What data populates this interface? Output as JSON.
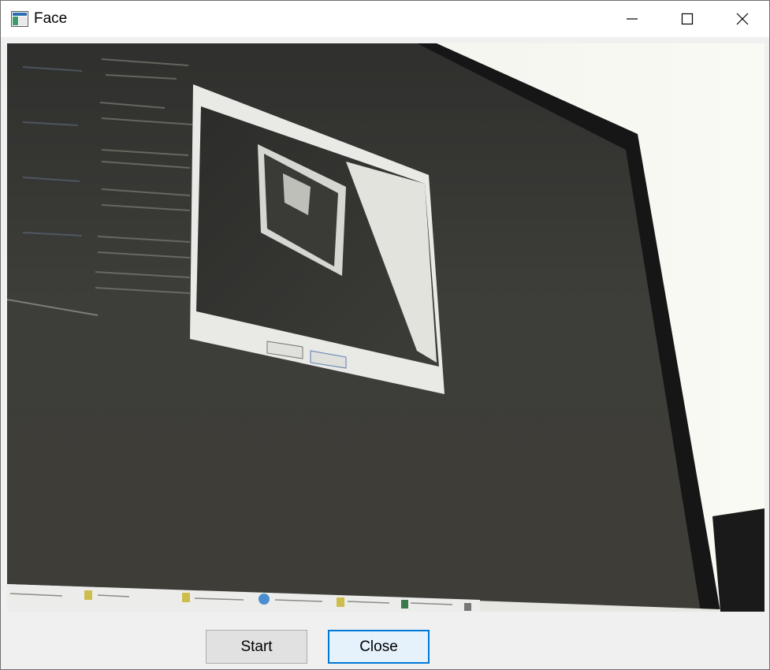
{
  "window": {
    "title": "Face",
    "controls": {
      "minimize_icon": "minimize-icon",
      "maximize_icon": "maximize-icon",
      "close_icon": "close-icon"
    }
  },
  "video": {
    "description_icon": "camera-feed-image"
  },
  "buttons": {
    "start_label": "Start",
    "close_label": "Close"
  },
  "colors": {
    "accent_focus": "#0078d7",
    "button_face": "#e1e1e1",
    "window_bg": "#f0f0f0"
  }
}
